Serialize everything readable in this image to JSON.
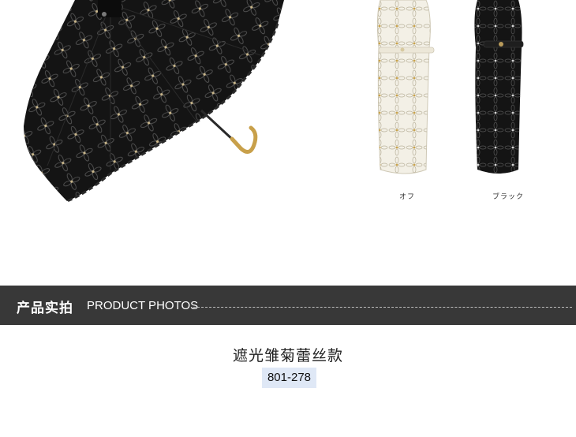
{
  "colors": {
    "section_bar": "#383838",
    "code_badge": "#dfe8f6",
    "umbrella_black": "#141414",
    "umbrella_off_white": "#f3f0e6",
    "embroidery_gold": "#c9a24a",
    "handle_gold": "#c8a04a"
  },
  "product_images": {
    "hero_icon": "open-umbrella-image",
    "variants": [
      {
        "icon": "folded-umbrella-off-white",
        "label": "オフ"
      },
      {
        "icon": "folded-umbrella-black",
        "label": "ブラック"
      }
    ]
  },
  "section": {
    "title_cn": "产品实拍",
    "title_en": "PRODUCT PHOTOS"
  },
  "product": {
    "name": "遮光雏菊蕾丝款",
    "code": "801-278"
  }
}
